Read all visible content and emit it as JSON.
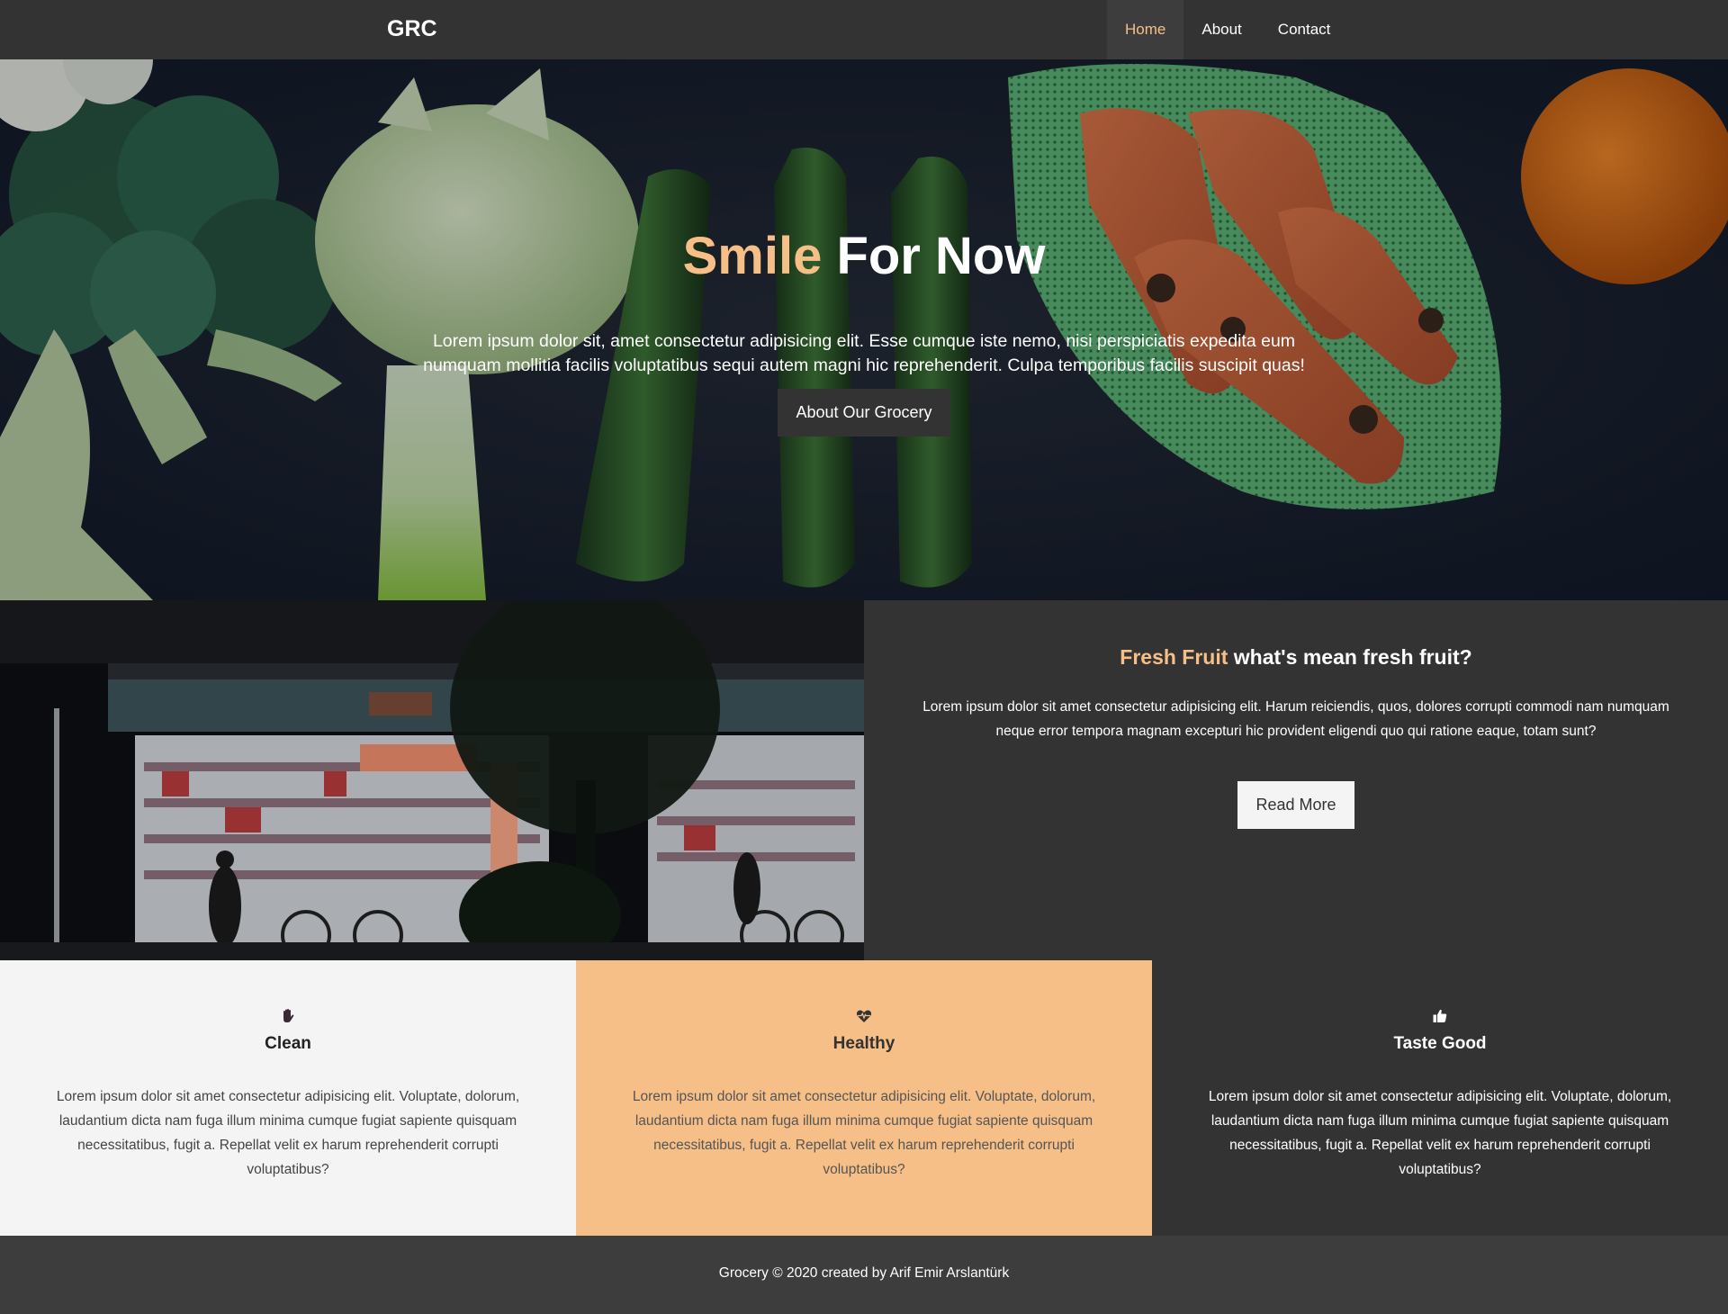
{
  "brand": {
    "logo": "GRC"
  },
  "nav": {
    "items": [
      {
        "label": "Home",
        "active": true
      },
      {
        "label": "About",
        "active": false
      },
      {
        "label": "Contact",
        "active": false
      }
    ]
  },
  "hero": {
    "title_accent": "Smile",
    "title_rest": " For Now",
    "text": "Lorem ipsum dolor sit, amet consectetur adipisicing elit. Esse cumque iste nemo, nisi perspiciatis expedita eum numquam mollitia facilis voluptatibus sequi autem magni hic reprehenderit. Culpa temporibus facilis suscipit quas!",
    "button": "About Our Grocery",
    "image": "vegetables-photo"
  },
  "about": {
    "image": "grocery-store-night-photo",
    "title_accent": "Fresh Fruit",
    "title_rest": " what's mean fresh fruit?",
    "text": "Lorem ipsum dolor sit amet consectetur adipisicing elit. Harum reiciendis, quos, dolores corrupti commodi nam numquam neque error tempora magnam excepturi hic provident eligendi quo qui ratione eaque, totam sunt?",
    "button": "Read More"
  },
  "features": [
    {
      "icon": "hand-icon",
      "title": "Clean",
      "text": "Lorem ipsum dolor sit amet consectetur adipisicing elit. Voluptate, dolorum, laudantium dicta nam fuga illum minima cumque fugiat sapiente quisquam necessitatibus, fugit a. Repellat velit ex harum reprehenderit corrupti voluptatibus?"
    },
    {
      "icon": "heartbeat-icon",
      "title": "Healthy",
      "text": "Lorem ipsum dolor sit amet consectetur adipisicing elit. Voluptate, dolorum, laudantium dicta nam fuga illum minima cumque fugiat sapiente quisquam necessitatibus, fugit a. Repellat velit ex harum reprehenderit corrupti voluptatibus?"
    },
    {
      "icon": "thumbs-up-icon",
      "title": "Taste Good",
      "text": "Lorem ipsum dolor sit amet consectetur adipisicing elit. Voluptate, dolorum, laudantium dicta nam fuga illum minima cumque fugiat sapiente quisquam necessitatibus, fugit a. Repellat velit ex harum reprehenderit corrupti voluptatibus?"
    }
  ],
  "footer": {
    "text": "Grocery © 2020 created by Arif Emir Arslantürk"
  },
  "colors": {
    "accent": "#f6bf87",
    "dark": "#333333",
    "light": "#f4f4f4",
    "footer": "#3d3d3d"
  }
}
